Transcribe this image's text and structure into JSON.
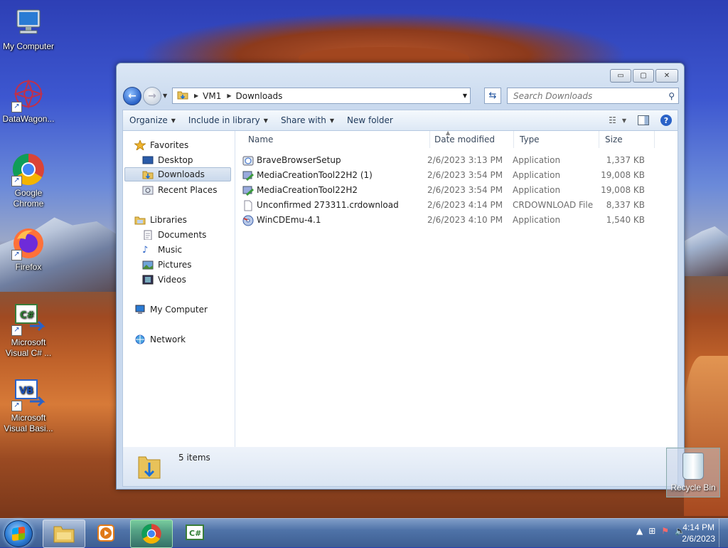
{
  "desktop": {
    "icons": [
      {
        "label": "My Computer",
        "icon": "computer-icon"
      },
      {
        "label": "DataWagon...",
        "icon": "datawagon-icon"
      },
      {
        "label": "Google Chrome",
        "icon": "chrome-icon"
      },
      {
        "label": "Firefox",
        "icon": "firefox-icon"
      },
      {
        "label": "Microsoft Visual C# ...",
        "icon": "visual-csharp-icon"
      },
      {
        "label": "Microsoft Visual Basi...",
        "icon": "visual-basic-icon"
      }
    ],
    "recycle_bin": "Recycle Bin"
  },
  "window": {
    "controls": {
      "minimize": "▭",
      "maximize": "▢",
      "close": "✕"
    },
    "address": {
      "segments": [
        "VM1",
        "Downloads"
      ]
    },
    "search": {
      "placeholder": "Search Downloads"
    },
    "toolbar": {
      "organize": "Organize",
      "include": "Include in library",
      "share": "Share with",
      "new_folder": "New folder"
    },
    "nav": {
      "favorites": "Favorites",
      "desktop": "Desktop",
      "downloads": "Downloads",
      "recent": "Recent Places",
      "libraries": "Libraries",
      "documents": "Documents",
      "music": "Music",
      "pictures": "Pictures",
      "videos": "Videos",
      "my_computer": "My Computer",
      "network": "Network",
      "selected": "Downloads"
    },
    "columns": {
      "name": "Name",
      "date": "Date modified",
      "type": "Type",
      "size": "Size"
    },
    "files": [
      {
        "name": "BraveBrowserSetup",
        "date": "2/6/2023 3:13 PM",
        "type": "Application",
        "size": "1,337 KB",
        "icon": "brave-setup-icon"
      },
      {
        "name": "MediaCreationTool22H2 (1)",
        "date": "2/6/2023 3:54 PM",
        "type": "Application",
        "size": "19,008 KB",
        "icon": "media-tool-icon"
      },
      {
        "name": "MediaCreationTool22H2",
        "date": "2/6/2023 3:54 PM",
        "type": "Application",
        "size": "19,008 KB",
        "icon": "media-tool-icon"
      },
      {
        "name": "Unconfirmed 273311.crdownload",
        "date": "2/6/2023 4:14 PM",
        "type": "CRDOWNLOAD File",
        "size": "8,337 KB",
        "icon": "blank-file-icon"
      },
      {
        "name": "WinCDEmu-4.1",
        "date": "2/6/2023 4:10 PM",
        "type": "Application",
        "size": "1,540 KB",
        "icon": "wincdemu-icon"
      }
    ],
    "status": {
      "count": "5 items"
    }
  },
  "taskbar": {
    "apps": [
      "windows-explorer",
      "media-player",
      "chrome",
      "visual-csharp"
    ],
    "clock": {
      "time": "4:14 PM",
      "date": "2/6/2023"
    }
  },
  "colors": {
    "accent": "#2a62c7",
    "selection": "#cad9ec"
  }
}
